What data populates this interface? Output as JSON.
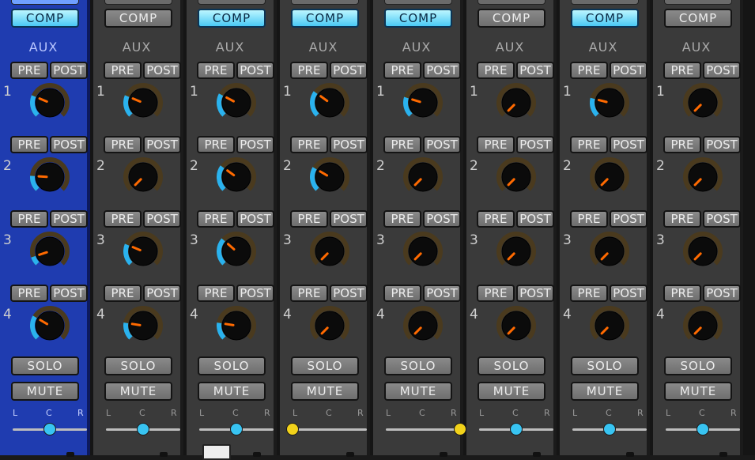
{
  "labels": {
    "comp": "COMP",
    "aux": "AUX",
    "pre": "PRE",
    "post": "POST",
    "solo": "SOLO",
    "mute": "MUTE",
    "pan_left": "L",
    "pan_center": "C",
    "pan_right": "R",
    "knob_numbers": [
      "1",
      "2",
      "3",
      "4"
    ]
  },
  "colors": {
    "selected_strip": "#1f3cb0",
    "strip": "#3a3a3a",
    "comp_on": "#49c9f5",
    "knob_arc_active": "#2ab2ee",
    "knob_pointer": "#ff6a00",
    "pan_dot_center": "#38c4f2",
    "pan_dot_offset": "#f2d21a"
  },
  "channels": [
    {
      "selected": true,
      "comp_on": true,
      "aux_levels": [
        0.25,
        0.18,
        0.1,
        0.28
      ],
      "pan": 0.5
    },
    {
      "selected": false,
      "comp_on": false,
      "aux_levels": [
        0.25,
        0.0,
        0.25,
        0.2
      ],
      "pan": 0.5
    },
    {
      "selected": false,
      "comp_on": true,
      "aux_levels": [
        0.27,
        0.3,
        0.32,
        0.2
      ],
      "pan": 0.5
    },
    {
      "selected": false,
      "comp_on": true,
      "aux_levels": [
        0.3,
        0.28,
        0.0,
        0.0
      ],
      "pan": 0.0
    },
    {
      "selected": false,
      "comp_on": true,
      "aux_levels": [
        0.23,
        0.0,
        0.0,
        0.0
      ],
      "pan": 1.0
    },
    {
      "selected": false,
      "comp_on": false,
      "aux_levels": [
        0.0,
        0.0,
        0.0,
        0.0
      ],
      "pan": 0.5
    },
    {
      "selected": false,
      "comp_on": true,
      "aux_levels": [
        0.22,
        0.0,
        0.0,
        0.0
      ],
      "pan": 0.5
    },
    {
      "selected": false,
      "comp_on": false,
      "aux_levels": [
        0.0,
        0.0,
        0.0,
        0.0
      ],
      "pan": 0.5
    }
  ]
}
